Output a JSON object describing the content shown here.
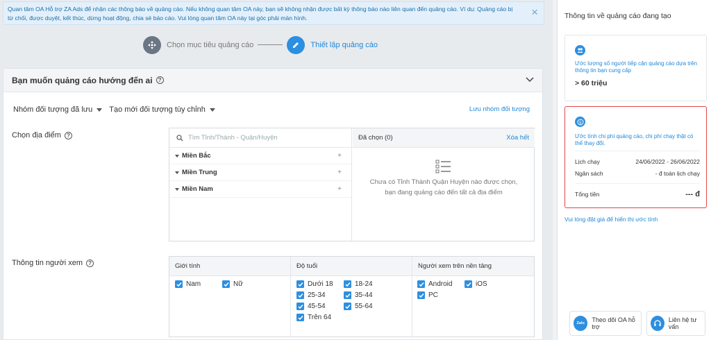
{
  "notice": {
    "text": "Quan tâm OA Hỗ trợ ZA Ads để nhận các thông báo về quảng cáo. Nếu không quan tâm OA này, bạn sẽ không nhận được bất kỳ thông báo nào liên quan đến quảng cáo. Ví dụ: Quảng cáo bị từ chối, được duyệt, kết thúc, dừng hoạt động, chia sẻ báo cáo. Vui lòng quan tâm OA này tại góc phải màn hình.",
    "close": "×"
  },
  "steps": [
    {
      "label": "Chọn mục tiêu quảng cáo",
      "icon": "target-icon"
    },
    {
      "label": "Thiết lập quảng cáo",
      "icon": "pencil-icon"
    }
  ],
  "section": {
    "title": "Bạn muốn quảng cáo hướng đến ai",
    "saved_audience": "Nhóm đối tượng đã lưu",
    "create_audience": "Tạo mới đối tượng tùy chỉnh",
    "save_group": "Lưu nhóm đối tượng"
  },
  "location": {
    "label": "Chọn địa điểm",
    "placeholder": "Tìm Tỉnh/Thành - Quận/Huyện",
    "regions": [
      "Miền Bắc",
      "Miền Trung",
      "Miền Nam"
    ],
    "selected_header": "Đã chọn (0)",
    "clear_all": "Xóa hết",
    "empty_message": "Chưa có Tỉnh Thành Quận Huyện nào được chọn, bạn đang quảng cáo đến tất cả địa điểm"
  },
  "viewer": {
    "label": "Thông tin người xem",
    "gender_header": "Giới tính",
    "age_header": "Độ tuổi",
    "platform_header": "Người xem trên nền tảng",
    "genders": [
      "Nam",
      "Nữ"
    ],
    "ages": [
      "Dưới 18",
      "18-24",
      "25-34",
      "35-44",
      "45-54",
      "55-64",
      "Trên 64"
    ],
    "platforms": [
      "Android",
      "iOS",
      "PC"
    ]
  },
  "summary": {
    "title": "Thông tin về quảng cáo đang tạo",
    "reach_desc": "Ước lượng số người tiếp cận quảng cáo dựa trên thông tin bạn cung cấp",
    "reach_value": "> 60 triệu",
    "cost_desc": "Ước tính chi phí quảng cáo, chi phí chạy thật có thể thay đổi.",
    "schedule_label": "Lịch chạy",
    "schedule_value": "24/06/2022 - 26/06/2022",
    "budget_label": "Ngân sách",
    "budget_value": "- đ toàn lịch chạy",
    "total_label": "Tổng tiền",
    "total_value": "--- đ",
    "hint": "Vui lòng đặt giá để hiển thị ước tính",
    "follow_button": "Theo dõi OA hỗ trợ",
    "follow_badge": "Zalo",
    "contact_button": "Liên hệ tư vấn"
  },
  "colors": {
    "accent": "#2d8fe0",
    "warning_border": "#e04848",
    "link": "#1f87d8"
  }
}
